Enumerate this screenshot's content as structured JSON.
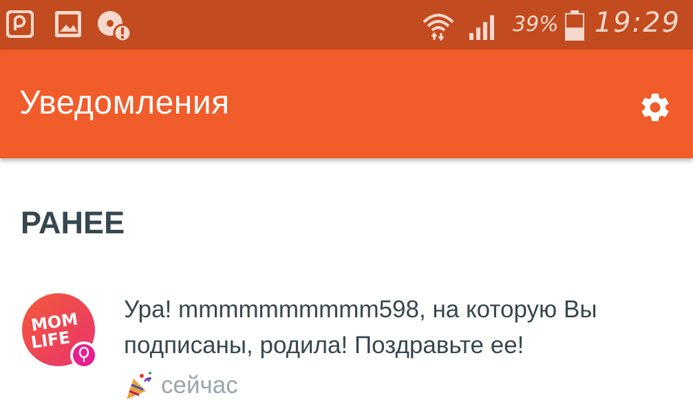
{
  "status_bar": {
    "time": "19:29",
    "battery_percent": "39%",
    "left_icons": [
      "app-notification-icon",
      "gallery-icon",
      "alert-disc-icon"
    ],
    "right_icons": [
      "wifi-icon",
      "signal-icon",
      "battery-icon"
    ],
    "background_color": "#C34B20"
  },
  "toolbar": {
    "title": "Уведомления",
    "settings_icon": "gear-icon",
    "background_color": "#F05C2A"
  },
  "section": {
    "header": "РАНЕЕ"
  },
  "notifications": [
    {
      "avatar_text": "MOM LIFE",
      "badge_icon": "balloon-icon",
      "text": "Ура! mmmmmmmmmm598, на которую Вы подписаны, родила! Поздравьте ее!",
      "emoji_icon": "party-popper-icon",
      "time": "сейчас"
    }
  ]
}
